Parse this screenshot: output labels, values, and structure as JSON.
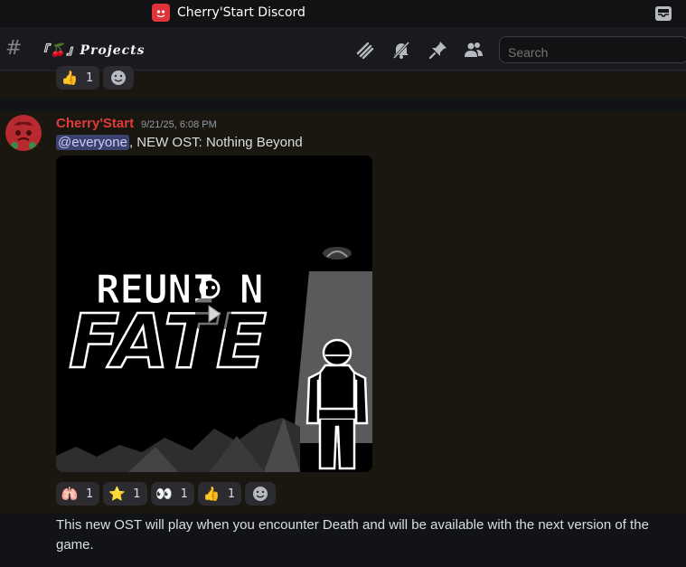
{
  "window": {
    "title": "Cherry'Start Discord"
  },
  "header": {
    "channel_name": "『🍒』𝑷𝒓𝒐𝒋𝒆𝒄𝒕𝒔",
    "search_placeholder": "Search"
  },
  "previous_message": {
    "reactions": [
      {
        "emoji": "👍",
        "count": "1"
      }
    ]
  },
  "message": {
    "author": "Cherry'Start",
    "author_color": "#e23a3a",
    "timestamp": "9/21/25, 6:08 PM",
    "mention": "@everyone",
    "text": ", NEW OST: Nothing Beyond",
    "media": {
      "title_top": "REUNI N",
      "title_bottom": "FATE"
    },
    "reactions": [
      {
        "emoji": "🫁",
        "count": "1"
      },
      {
        "emoji": "⭐",
        "count": "1"
      },
      {
        "emoji": "👀",
        "count": "1"
      },
      {
        "emoji": "👍",
        "count": "1"
      }
    ]
  },
  "follow_up": {
    "text": "This new OST will play when you encounter Death and will be available with the next version of the game."
  }
}
